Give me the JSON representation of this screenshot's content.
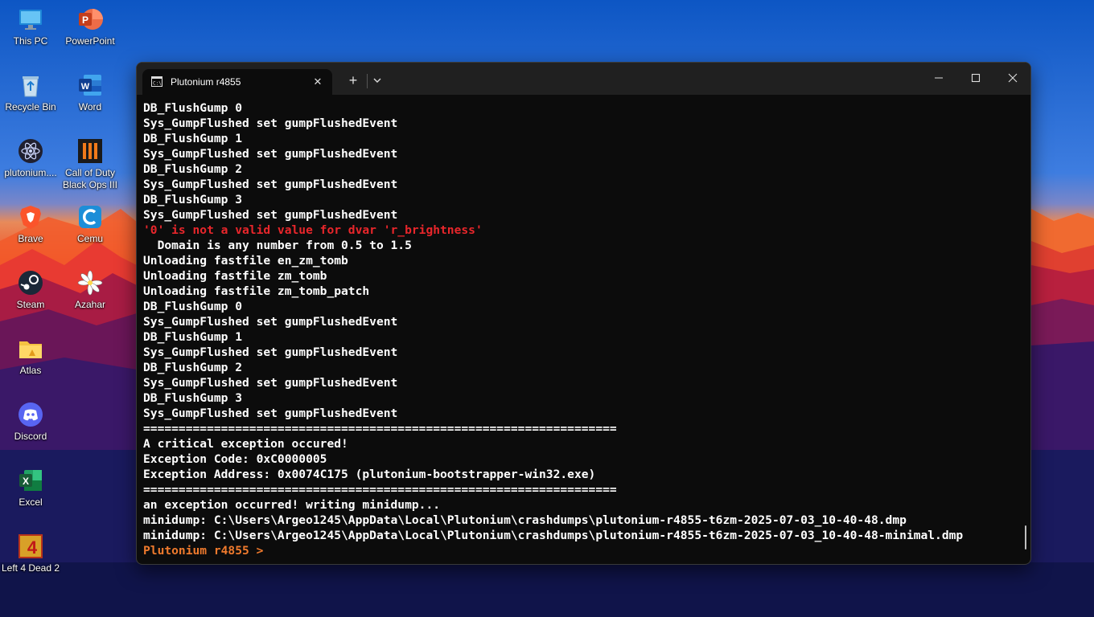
{
  "desktop": {
    "icons": [
      {
        "label": "This PC",
        "icon": "monitor-icon"
      },
      {
        "label": "PowerPoint",
        "icon": "powerpoint-icon"
      },
      {
        "label": "Recycle Bin",
        "icon": "recycle-bin-icon"
      },
      {
        "label": "Word",
        "icon": "word-icon"
      },
      {
        "label": "plutonium....",
        "icon": "atom-icon"
      },
      {
        "label": "Call of Duty Black Ops III",
        "icon": "bo3-icon"
      },
      {
        "label": "Brave",
        "icon": "brave-icon"
      },
      {
        "label": "Cemu",
        "icon": "cemu-icon"
      },
      {
        "label": "Steam",
        "icon": "steam-icon"
      },
      {
        "label": "Azahar",
        "icon": "azahar-icon"
      },
      {
        "label": "Atlas",
        "icon": "folder-icon"
      },
      {
        "label": "Discord",
        "icon": "discord-icon"
      },
      {
        "label": "Excel",
        "icon": "excel-icon"
      },
      {
        "label": "Left 4 Dead 2",
        "icon": "l4d2-icon"
      }
    ]
  },
  "terminal": {
    "tab_title": "Plutonium r4855",
    "tab_close": "✕",
    "new_tab": "+",
    "lines": [
      {
        "text": "DB_FlushGump 0",
        "style": "normal"
      },
      {
        "text": "Sys_GumpFlushed set gumpFlushedEvent",
        "style": "normal"
      },
      {
        "text": "DB_FlushGump 1",
        "style": "normal"
      },
      {
        "text": "Sys_GumpFlushed set gumpFlushedEvent",
        "style": "normal"
      },
      {
        "text": "DB_FlushGump 2",
        "style": "normal"
      },
      {
        "text": "Sys_GumpFlushed set gumpFlushedEvent",
        "style": "normal"
      },
      {
        "text": "DB_FlushGump 3",
        "style": "normal"
      },
      {
        "text": "Sys_GumpFlushed set gumpFlushedEvent",
        "style": "normal"
      },
      {
        "text": "'0' is not a valid value for dvar 'r_brightness'",
        "style": "error"
      },
      {
        "text": "  Domain is any number from 0.5 to 1.5",
        "style": "normal"
      },
      {
        "text": "Unloading fastfile en_zm_tomb",
        "style": "normal"
      },
      {
        "text": "Unloading fastfile zm_tomb",
        "style": "normal"
      },
      {
        "text": "Unloading fastfile zm_tomb_patch",
        "style": "normal"
      },
      {
        "text": "DB_FlushGump 0",
        "style": "normal"
      },
      {
        "text": "Sys_GumpFlushed set gumpFlushedEvent",
        "style": "normal"
      },
      {
        "text": "DB_FlushGump 1",
        "style": "normal"
      },
      {
        "text": "Sys_GumpFlushed set gumpFlushedEvent",
        "style": "normal"
      },
      {
        "text": "DB_FlushGump 2",
        "style": "normal"
      },
      {
        "text": "Sys_GumpFlushed set gumpFlushedEvent",
        "style": "normal"
      },
      {
        "text": "DB_FlushGump 3",
        "style": "normal"
      },
      {
        "text": "Sys_GumpFlushed set gumpFlushedEvent",
        "style": "normal"
      },
      {
        "text": "===================================================================",
        "style": "normal"
      },
      {
        "text": "A critical exception occured!",
        "style": "normal"
      },
      {
        "text": "Exception Code: 0xC0000005",
        "style": "normal"
      },
      {
        "text": "Exception Address: 0x0074C175 (plutonium-bootstrapper-win32.exe)",
        "style": "normal"
      },
      {
        "text": "===================================================================",
        "style": "normal"
      },
      {
        "text": "an exception occurred! writing minidump...",
        "style": "normal"
      },
      {
        "text": "minidump: C:\\Users\\Argeo1245\\AppData\\Local\\Plutonium\\crashdumps\\plutonium-r4855-t6zm-2025-07-03_10-40-48.dmp",
        "style": "normal"
      },
      {
        "text": "minidump: C:\\Users\\Argeo1245\\AppData\\Local\\Plutonium\\crashdumps\\plutonium-r4855-t6zm-2025-07-03_10-40-48-minimal.dmp",
        "style": "normal"
      },
      {
        "text": "Plutonium r4855 >",
        "style": "prompt"
      }
    ]
  },
  "colors": {
    "terminal_bg": "#0c0c0c",
    "titlebar_bg": "#202020",
    "error_text": "#e8262b",
    "prompt_text": "#ef7a2d"
  }
}
